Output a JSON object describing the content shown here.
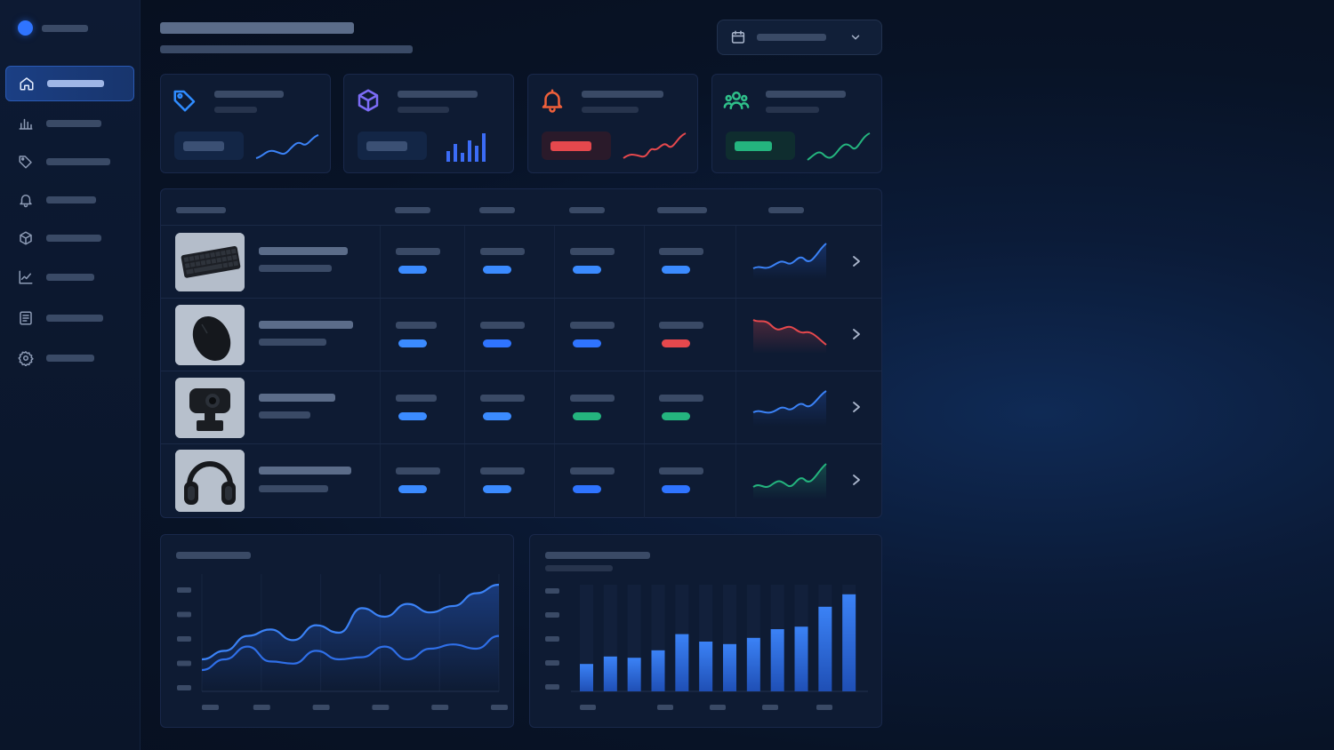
{
  "colors": {
    "accent_blue": "#2f74ff",
    "bright_blue": "#3b8bff",
    "alert_red": "#e5484d",
    "success_green": "#24b47e",
    "purple": "#7c6cf6",
    "orange_red": "#f0603a",
    "teal_green": "#2fc08a"
  },
  "sidebar": {
    "brand_icon": "circle-logo-icon",
    "items": [
      {
        "icon": "home-icon",
        "active": true
      },
      {
        "icon": "bar-chart-icon",
        "active": false
      },
      {
        "icon": "tag-icon",
        "active": false
      },
      {
        "icon": "bell-icon",
        "active": false
      },
      {
        "icon": "box-icon",
        "active": false
      },
      {
        "icon": "line-chart-icon",
        "active": false
      },
      {
        "icon": "document-icon",
        "active": false
      },
      {
        "icon": "settings-gear-icon",
        "active": false
      }
    ]
  },
  "header": {
    "date_picker": {
      "icon": "calendar-icon",
      "dropdown_icon": "chevron-down-icon"
    }
  },
  "kpis": [
    {
      "icon": "price-tag-icon",
      "icon_color": "#2f8cff",
      "pill_color": "#3b5074",
      "trend": "line-up",
      "trend_color": "#3b82f6"
    },
    {
      "icon": "cube-icon",
      "icon_color": "#7c6cf6",
      "pill_color": "#3b5074",
      "trend": "bars-up",
      "trend_color": "#3b6cf6"
    },
    {
      "icon": "bell-alert-icon",
      "icon_color": "#f0603a",
      "pill_color": "#e5484d",
      "trend": "line-up",
      "trend_color": "#e5484d"
    },
    {
      "icon": "users-group-icon",
      "icon_color": "#2fc08a",
      "pill_color": "#24b47e",
      "trend": "line-up",
      "trend_color": "#24b47e"
    }
  ],
  "table": {
    "rows": [
      {
        "product_image": "keyboard",
        "statuses": [
          "#3b8bff",
          "#3b8bff",
          "#3b8bff",
          "#3b8bff"
        ],
        "trend": "up",
        "trend_color": "#3b82f6"
      },
      {
        "product_image": "mouse",
        "statuses": [
          "#3b8bff",
          "#2f74ff",
          "#2f74ff",
          "#e5484d"
        ],
        "trend": "down",
        "trend_color": "#e5484d"
      },
      {
        "product_image": "webcam",
        "statuses": [
          "#3b8bff",
          "#3b8bff",
          "#24b47e",
          "#24b47e"
        ],
        "trend": "up",
        "trend_color": "#3b82f6"
      },
      {
        "product_image": "headphones",
        "statuses": [
          "#3b8bff",
          "#3b8bff",
          "#2f74ff",
          "#2f74ff"
        ],
        "trend": "up",
        "trend_color": "#24b47e"
      }
    ]
  },
  "chart_data": [
    {
      "type": "line",
      "series": [
        {
          "values": [
            30,
            38,
            52,
            58,
            48,
            62,
            55,
            78,
            70,
            82,
            74,
            80,
            92,
            100
          ]
        },
        {
          "values": [
            20,
            30,
            42,
            28,
            26,
            38,
            30,
            32,
            42,
            30,
            40,
            44,
            40,
            52
          ]
        }
      ],
      "ylim": [
        0,
        110
      ]
    },
    {
      "type": "bar",
      "values": [
        22,
        28,
        27,
        33,
        46,
        40,
        38,
        43,
        50,
        52,
        68,
        78
      ],
      "ylim": [
        0,
        90
      ]
    }
  ]
}
